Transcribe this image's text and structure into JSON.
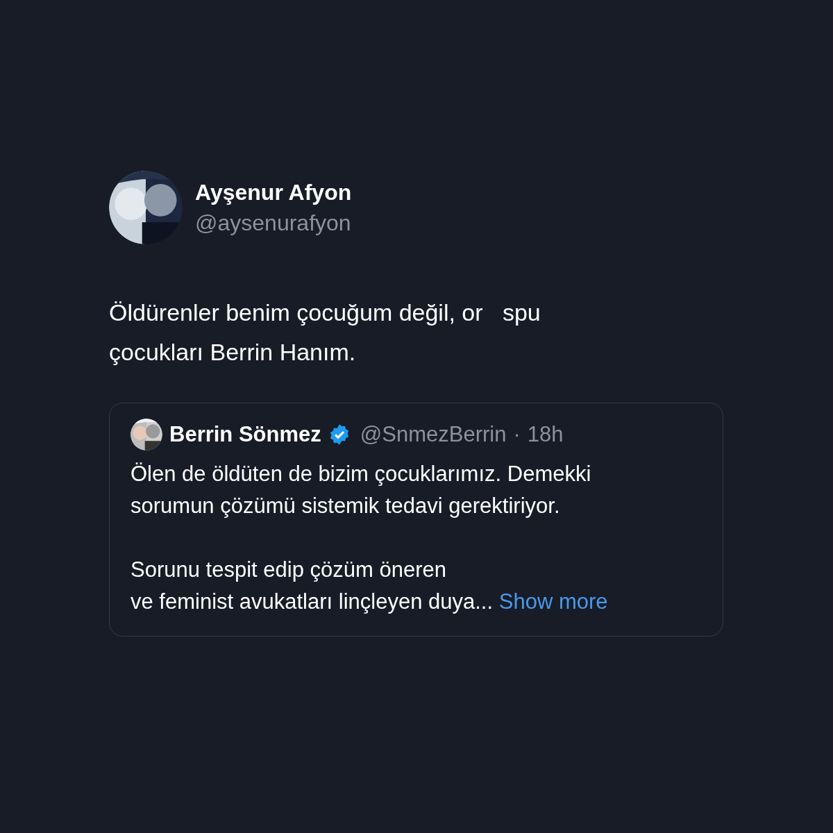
{
  "author": {
    "name": "Ayşenur Afyon",
    "handle": "@aysenurafyon"
  },
  "tweet": {
    "lines": [
      "Öldürenler benim çocuğum değil, or   spu",
      "çocukları Berrin Hanım."
    ]
  },
  "quoted": {
    "name": "Berrin Sönmez",
    "verified": true,
    "handle": "@SnmezBerrin",
    "separator": "·",
    "time": "18h",
    "paragraphs": [
      {
        "lines": [
          "Ölen de öldüten de bizim çocuklarımız. Demekki",
          "sorumun çözümü sistemik tedavi gerektiriyor."
        ]
      },
      {
        "lines": [
          "Sorunu tespit edip çözüm öneren",
          "ve feminist avukatları linçleyen duya..."
        ]
      }
    ],
    "show_more": "Show more"
  }
}
